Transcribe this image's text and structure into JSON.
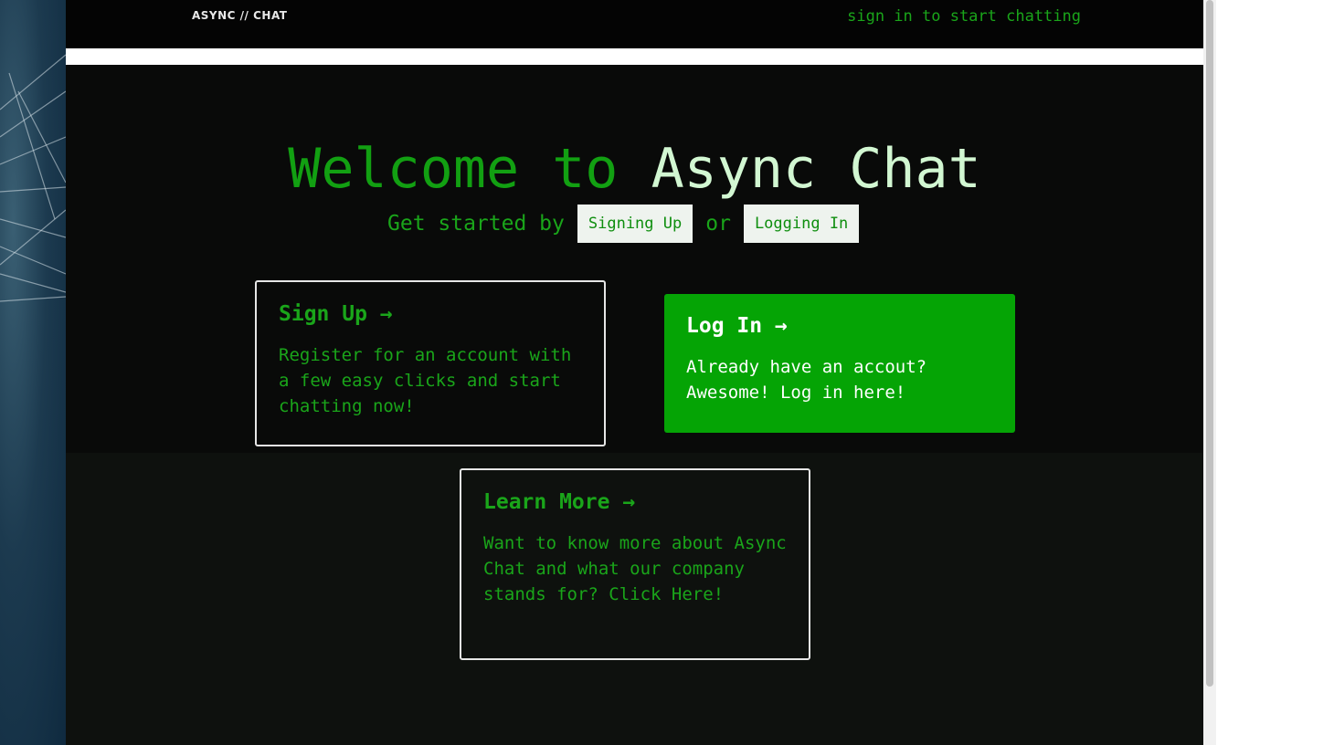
{
  "header": {
    "logo_text": "ASYNC // CHAT",
    "signin_link": "sign in to start chatting"
  },
  "hero": {
    "title_part1": "Welcome to ",
    "title_part2": "Async Chat",
    "subtitle_prefix": "Get started by",
    "signup_pill": "Signing Up",
    "subtitle_or": "or",
    "login_pill": "Logging In"
  },
  "cards": {
    "signup": {
      "title": "Sign Up →",
      "text": "Register for an account with a few easy clicks and start chatting now!"
    },
    "login": {
      "title": "Log In →",
      "text": "Already have an accout? Awesome! Log in here!"
    },
    "learn": {
      "title": "Learn More →",
      "text": "Want to know more about Async Chat and what our company stands for? Click Here!"
    }
  },
  "colors": {
    "accent_green": "#1aa51a",
    "filled_card": "#05a405",
    "background": "#0b0d0b"
  }
}
